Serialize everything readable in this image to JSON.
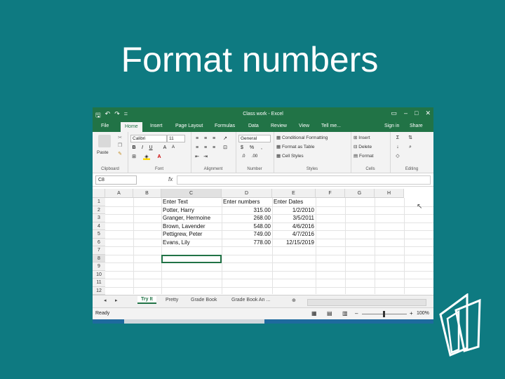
{
  "slide": {
    "title": "Format numbers"
  },
  "excel": {
    "window_title": "Class work - Excel",
    "qat": {
      "save": "🖫",
      "undo": "↶",
      "redo": "↷",
      "customize": "="
    },
    "window_controls": {
      "ribbon_display": "▭",
      "minimize": "–",
      "maximize": "□",
      "close": "✕"
    },
    "menu": {
      "tabs": [
        "File",
        "Home",
        "Insert",
        "Page Layout",
        "Formulas",
        "Data",
        "Review",
        "View",
        "Tell me..."
      ],
      "sign_in": "Sign in",
      "share": "Share"
    },
    "ribbon": {
      "clipboard": {
        "label": "Clipboard",
        "paste": "Paste"
      },
      "font": {
        "label": "Font",
        "name": "Calibri",
        "size": "11",
        "bold": "B",
        "italic": "I",
        "underline": "U"
      },
      "alignment": {
        "label": "Alignment"
      },
      "number": {
        "label": "Number",
        "format": "General",
        "currency": "$",
        "percent": "%",
        "comma": ","
      },
      "styles": {
        "label": "Styles",
        "conditional": "Conditional Formatting",
        "format_table": "Format as Table",
        "cell_styles": "Cell Styles"
      },
      "cells": {
        "label": "Cells",
        "insert": "Insert",
        "delete": "Delete",
        "format": "Format"
      },
      "editing": {
        "label": "Editing"
      }
    },
    "formula_bar": {
      "name_box": "C8",
      "fx": "fx"
    },
    "columns": [
      "A",
      "B",
      "C",
      "D",
      "E",
      "F",
      "G",
      "H"
    ],
    "rows": [
      "1",
      "2",
      "3",
      "4",
      "5",
      "6",
      "7",
      "8",
      "9",
      "10",
      "11",
      "12"
    ],
    "cells": {
      "C1": "Enter Text",
      "D1": "Enter numbers",
      "E1": "Enter Dates",
      "C2": "Potter, Harry",
      "D2": "315.00",
      "E2": "1/2/2010",
      "C3": "Granger, Hermoine",
      "D3": "268.00",
      "E3": "3/5/2011",
      "C4": "Brown, Lavender",
      "D4": "548.00",
      "E4": "4/6/2016",
      "C5": "Pettigrew, Peter",
      "D5": "749.00",
      "E5": "4/7/2016",
      "C6": "Evans, Lily",
      "D6": "778.00",
      "E6": "12/15/2019"
    },
    "sheets": [
      "Try It",
      "Pretty",
      "Grade Book",
      "Grade Book An ..."
    ],
    "status": {
      "ready": "Ready",
      "zoom": "100%"
    }
  }
}
